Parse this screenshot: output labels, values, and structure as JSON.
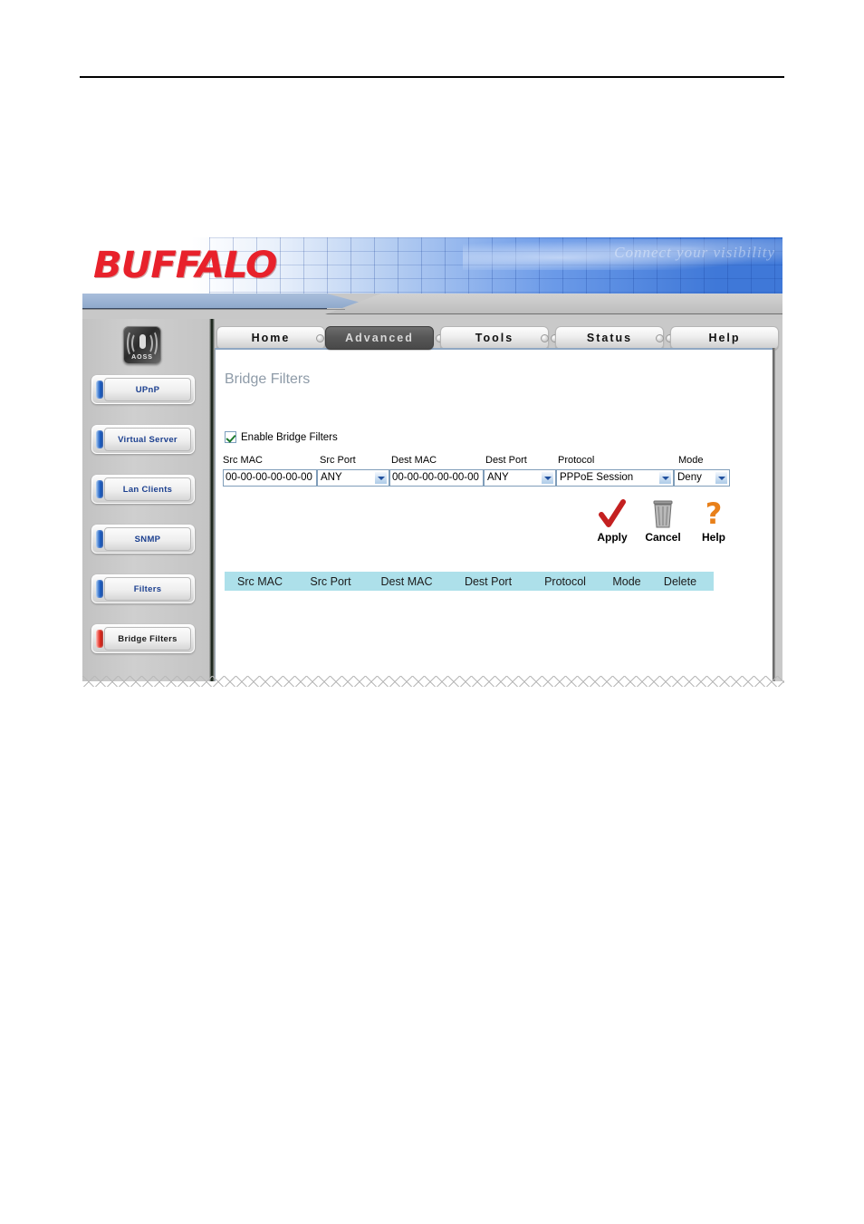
{
  "document": {
    "rule_visible": true
  },
  "banner": {
    "brand": "BUFFALO",
    "watermark": "Connect your visibility"
  },
  "sidebar": {
    "aoss_label": "AOSS",
    "items": [
      {
        "label": "UPnP",
        "accent": "#1d5fc4",
        "active": false
      },
      {
        "label": "Virtual Server",
        "accent": "#1d5fc4",
        "active": false
      },
      {
        "label": "Lan Clients",
        "accent": "#1d5fc4",
        "active": false
      },
      {
        "label": "SNMP",
        "accent": "#1d5fc4",
        "active": false
      },
      {
        "label": "Filters",
        "accent": "#1d5fc4",
        "active": false
      },
      {
        "label": "Bridge Filters",
        "accent": "#e02a1f",
        "active": true
      }
    ]
  },
  "tabs": [
    {
      "label": "Home",
      "active": false
    },
    {
      "label": "Advanced",
      "active": true
    },
    {
      "label": "Tools",
      "active": false
    },
    {
      "label": "Status",
      "active": false
    },
    {
      "label": "Help",
      "active": false
    }
  ],
  "main": {
    "title": "Bridge Filters",
    "enable": {
      "label": "Enable Bridge Filters",
      "checked": true
    },
    "fields": {
      "src_mac": {
        "label": "Src MAC",
        "value": "00-00-00-00-00-00"
      },
      "src_port": {
        "label": "Src Port",
        "value": "ANY"
      },
      "dest_mac": {
        "label": "Dest MAC",
        "value": "00-00-00-00-00-00"
      },
      "dest_port": {
        "label": "Dest Port",
        "value": "ANY"
      },
      "protocol": {
        "label": "Protocol",
        "value": "PPPoE Session"
      },
      "mode": {
        "label": "Mode",
        "value": "Deny"
      }
    },
    "actions": [
      {
        "label": "Apply",
        "icon": "red-checkmark-icon",
        "color": "#c42020"
      },
      {
        "label": "Cancel",
        "icon": "trash-can-icon",
        "color": "#8a8a8a"
      },
      {
        "label": "Help",
        "icon": "orange-question-mark-icon",
        "color": "#e8801a"
      }
    ],
    "table": {
      "columns": [
        "Src MAC",
        "Src Port",
        "Dest MAC",
        "Dest Port",
        "Protocol",
        "Mode",
        "Delete"
      ],
      "rows": [],
      "header_bg": "#ade0ea"
    }
  },
  "colors": {
    "brand_red": "#e8212b",
    "title_gray": "#8e9ba8",
    "nav_blue": "#1b3f8f",
    "table_header": "#ade0ea"
  }
}
